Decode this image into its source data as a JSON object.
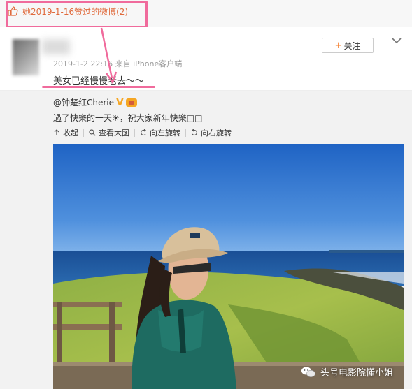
{
  "liked_header": {
    "text": "她2019-1-16赞过的微博(2)",
    "icon": "thumb-up-icon"
  },
  "post": {
    "meta": "2019-1-2 22:16 来自 iPhone客户端",
    "text": "美女已经慢慢老去～～",
    "follow_label": "关注",
    "follow_icon": "plus-icon",
    "menu_icon": "chevron-down-icon"
  },
  "repost": {
    "author": "@钟楚红Cherie",
    "text": "過了快樂的一天☀，祝大家新年快樂□□",
    "tools": [
      {
        "label": "收起",
        "icon": "collapse-icon"
      },
      {
        "label": "查看大图",
        "icon": "zoom-icon"
      },
      {
        "label": "向左旋转",
        "icon": "rotate-left-icon"
      },
      {
        "label": "向右旋转",
        "icon": "rotate-right-icon"
      }
    ]
  },
  "watermark": {
    "text": "头号电影院懂小姐",
    "icon": "wechat-icon"
  },
  "colors": {
    "highlight": "#f06b9c",
    "link_orange": "#e06a3c",
    "follow_plus": "#f67d2b",
    "verified": "#f5a623"
  }
}
